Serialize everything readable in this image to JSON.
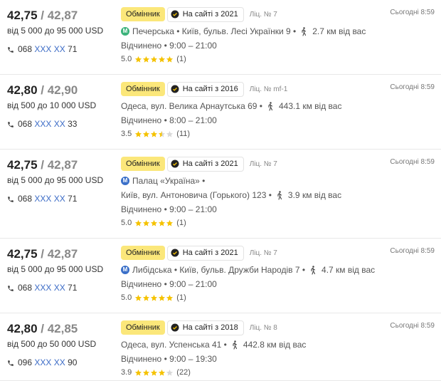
{
  "offers": [
    {
      "buy": "42,75",
      "sell": "42,87",
      "range": "від 5 000 до 95 000 USD",
      "phone_prefix": "068",
      "phone_masked": "XXX XX",
      "phone_suffix": "71",
      "type": "Обмінник",
      "on_site": "На сайті з 2021",
      "license": "Ліц. № 7",
      "metro": {
        "letter": "М",
        "color": "#3bb27a"
      },
      "lines": [
        {
          "metro": true,
          "address": "Печерська • Київ, бульв. Лесі Українки 9 •",
          "walk": true,
          "distance": "2.7  км від вас"
        }
      ],
      "hours": "Відчинено  • 9:00 – 21:00",
      "rating": "5.0",
      "stars": 5,
      "reviews": "(1)",
      "time": "Сьогодні 8:59"
    },
    {
      "buy": "42,80",
      "sell": "42,90",
      "range": "від 500 до 10 000 USD",
      "phone_prefix": "068",
      "phone_masked": "XXX XX",
      "phone_suffix": "33",
      "type": "Обмінник",
      "on_site": "На сайті з 2016",
      "license": "Ліц. № mf-1",
      "metro": null,
      "lines": [
        {
          "metro": false,
          "address": "Одеса, вул. Велика Арнаутська 69 •",
          "walk": true,
          "distance": "443.1  км від вас"
        }
      ],
      "hours": "Відчинено  • 8:00 – 21:00",
      "rating": "3.5",
      "stars": 3.5,
      "reviews": "(11)",
      "time": "Сьогодні 8:59"
    },
    {
      "buy": "42,75",
      "sell": "42,87",
      "range": "від 5 000 до 95 000 USD",
      "phone_prefix": "068",
      "phone_masked": "XXX XX",
      "phone_suffix": "71",
      "type": "Обмінник",
      "on_site": "На сайті з 2021",
      "license": "Ліц. № 7",
      "metro": {
        "letter": "М",
        "color": "#3a6fc8"
      },
      "lines": [
        {
          "metro": true,
          "address": "Палац «Україна» •",
          "walk": false,
          "distance": ""
        },
        {
          "metro": false,
          "address": "Київ, вул. Антоновича (Горького) 123 •",
          "walk": true,
          "distance": "3.9  км від вас"
        }
      ],
      "hours": "Відчинено  • 9:00 – 21:00",
      "rating": "5.0",
      "stars": 5,
      "reviews": "(1)",
      "time": "Сьогодні 8:59"
    },
    {
      "buy": "42,75",
      "sell": "42,87",
      "range": "від 5 000 до 95 000 USD",
      "phone_prefix": "068",
      "phone_masked": "XXX XX",
      "phone_suffix": "71",
      "type": "Обмінник",
      "on_site": "На сайті з 2021",
      "license": "Ліц. № 7",
      "metro": {
        "letter": "М",
        "color": "#3a6fc8"
      },
      "lines": [
        {
          "metro": true,
          "address": "Либідська • Київ, бульв. Дружби Народів 7 •",
          "walk": true,
          "distance": "4.7  км від вас"
        }
      ],
      "hours": "Відчинено  • 9:00 – 21:00",
      "rating": "5.0",
      "stars": 5,
      "reviews": "(1)",
      "time": "Сьогодні 8:59"
    },
    {
      "buy": "42,80",
      "sell": "42,85",
      "range": "від 500 до 50 000 USD",
      "phone_prefix": "096",
      "phone_masked": "XXX XX",
      "phone_suffix": "90",
      "type": "Обмінник",
      "on_site": "На сайті з 2018",
      "license": "Ліц. № 8",
      "metro": null,
      "lines": [
        {
          "metro": false,
          "address": "Одеса, вул. Успенська 41 •",
          "walk": true,
          "distance": "442.8  км від вас"
        }
      ],
      "hours": "Відчинено  • 9:00 – 19:30",
      "rating": "3.9",
      "stars": 4,
      "reviews": "(22)",
      "time": "Сьогодні 8:59"
    }
  ],
  "colors": {
    "star_on": "#f5c200",
    "star_off": "#d8d8d8",
    "phone_masked": "#3b6bc6",
    "badge_type": "#fbe77a"
  },
  "icons": {
    "phone": "phone-icon",
    "verified": "verified-check-icon",
    "walk": "walking-person-icon",
    "metro": "metro-icon",
    "star": "star-icon"
  }
}
